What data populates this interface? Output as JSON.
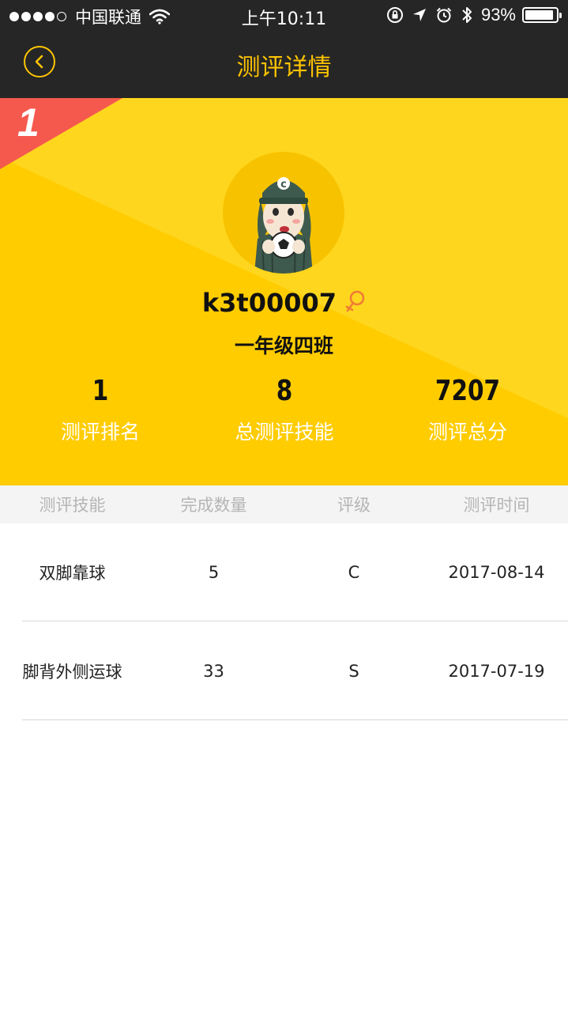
{
  "status_bar": {
    "carrier": "中国联通",
    "time": "上午10:11",
    "battery": "93%",
    "battery_level": 0.93,
    "icons": [
      "signal-dots",
      "wifi-icon",
      "rotation-lock-icon",
      "location-icon",
      "alarm-icon",
      "bluetooth-icon",
      "battery-icon"
    ]
  },
  "nav": {
    "title": "测评详情",
    "back_icon": "chevron-left-icon"
  },
  "hero": {
    "rank_badge": "1",
    "username": "k3t00007",
    "gender_icon": "female-icon",
    "class_name": "一年级四班",
    "stats": [
      {
        "value": "1",
        "label": "测评排名"
      },
      {
        "value": "8",
        "label": "总测评技能"
      },
      {
        "value": "7207",
        "label": "测评总分"
      }
    ]
  },
  "table": {
    "headers": [
      "测评技能",
      "完成数量",
      "评级",
      "测评时间"
    ],
    "rows": [
      {
        "skill": "双脚靠球",
        "count": "5",
        "grade": "C",
        "date": "2017-08-14"
      },
      {
        "skill": "脚背外侧运球",
        "count": "33",
        "grade": "S",
        "date": "2017-07-19"
      }
    ]
  },
  "colors": {
    "accent": "#FFC400",
    "hero_bg": "#FFD10F",
    "rank_corner": "#F5594E",
    "dark_bar": "#262626"
  }
}
